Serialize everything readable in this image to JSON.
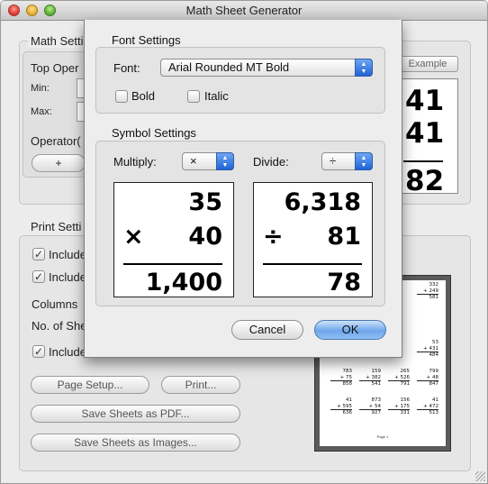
{
  "window": {
    "title": "Math Sheet Generator"
  },
  "background": {
    "math_settings_title": "Math Setti",
    "top_operand_label": "Top Oper",
    "min_label": "Min:",
    "max_label": "Max:",
    "operator_label": "Operator(",
    "add_button_label": "+",
    "example_button_label": "Example",
    "preview_lines": [
      "41",
      "41",
      "82"
    ],
    "print_settings_title": "Print Setti",
    "include_1": "Include",
    "include_2": "Include",
    "columns_label": "Columns",
    "no_sheets_label": "No. of She",
    "include_3": "Include",
    "page_setup_button": "Page Setup...",
    "print_button": "Print...",
    "save_pdf_button": "Save Sheets as PDF...",
    "save_images_button": "Save Sheets as Images..."
  },
  "sheet_preview": {
    "rows": [
      [
        [
          "",
          "",
          ""
        ],
        [
          "",
          "",
          ""
        ],
        [
          "",
          "",
          ""
        ],
        [
          "332",
          "+ 249",
          "581"
        ]
      ],
      [
        [
          "",
          "",
          ""
        ],
        [
          "",
          "",
          ""
        ],
        [
          "",
          "",
          ""
        ],
        [
          "",
          "",
          ""
        ]
      ],
      [
        [
          "",
          "",
          ""
        ],
        [
          "",
          "",
          ""
        ],
        [
          "",
          "",
          ""
        ],
        [
          "53",
          "+ 431",
          "484"
        ]
      ],
      [
        [
          "783",
          "+ 75",
          "858"
        ],
        [
          "159",
          "+ 382",
          "541"
        ],
        [
          "265",
          "+ 526",
          "791"
        ],
        [
          "799",
          "+ 48",
          "847"
        ]
      ],
      [
        [
          "41",
          "+ 595",
          "636"
        ],
        [
          "873",
          "+ 54",
          "927"
        ],
        [
          "156",
          "+ 175",
          "331"
        ],
        [
          "41",
          "+ 472",
          "513"
        ]
      ]
    ],
    "footer": "Page 1"
  },
  "dialog": {
    "font_settings_title": "Font Settings",
    "font_label": "Font:",
    "font_value": "Arial Rounded MT Bold",
    "bold_label": "Bold",
    "bold_checked": false,
    "italic_label": "Italic",
    "italic_checked": false,
    "symbol_settings_title": "Symbol Settings",
    "multiply_label": "Multiply:",
    "multiply_value": "×",
    "divide_label": "Divide:",
    "divide_value": "÷",
    "multiply_sample": {
      "top": "35",
      "op": "×",
      "bottom": "40",
      "result": "1,400"
    },
    "divide_sample": {
      "top": "6,318",
      "op": "÷",
      "bottom": "81",
      "result": "78"
    },
    "cancel_label": "Cancel",
    "ok_label": "OK"
  }
}
